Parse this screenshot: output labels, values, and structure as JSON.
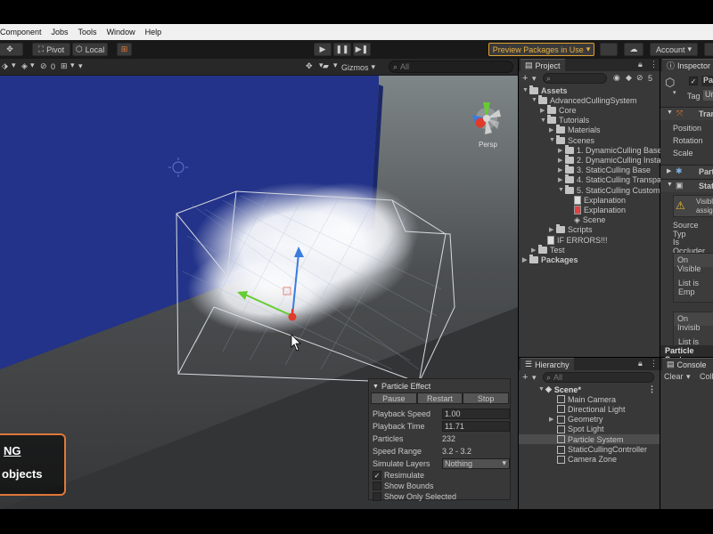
{
  "menu": [
    "Component",
    "Jobs",
    "Tools",
    "Window",
    "Help"
  ],
  "toolbar": {
    "pivot": "Pivot",
    "local": "Local",
    "preview_packages": "Preview Packages in Use",
    "account": "Account"
  },
  "scene_toolbar": {
    "hidden_count": "0",
    "gizmos": "Gizmos",
    "search_placeholder": "All",
    "persp": "Persp"
  },
  "project": {
    "tab": "Project",
    "counter": "5",
    "tree": [
      {
        "label": "Assets",
        "depth": 0,
        "icon": "folder",
        "expanded": true,
        "bold": true
      },
      {
        "label": "AdvancedCullingSystem",
        "depth": 1,
        "icon": "folder",
        "expanded": true
      },
      {
        "label": "Core",
        "depth": 2,
        "icon": "folder",
        "expanded": false
      },
      {
        "label": "Tutorials",
        "depth": 2,
        "icon": "folder",
        "expanded": true
      },
      {
        "label": "Materials",
        "depth": 3,
        "icon": "folder",
        "expanded": false
      },
      {
        "label": "Scenes",
        "depth": 3,
        "icon": "folder",
        "expanded": true
      },
      {
        "label": "1. DynamicCulling Base",
        "depth": 4,
        "icon": "folder",
        "expanded": false
      },
      {
        "label": "2. DynamicCulling Insta",
        "depth": 4,
        "icon": "folder",
        "expanded": false
      },
      {
        "label": "3. StaticCulling Base",
        "depth": 4,
        "icon": "folder",
        "expanded": false
      },
      {
        "label": "4. StaticCulling Transpa",
        "depth": 4,
        "icon": "folder",
        "expanded": false
      },
      {
        "label": "5. StaticCulling Custom",
        "depth": 4,
        "icon": "folder",
        "expanded": true
      },
      {
        "label": "Explanation",
        "depth": 5,
        "icon": "doc"
      },
      {
        "label": "Explanation",
        "depth": 5,
        "icon": "pdf"
      },
      {
        "label": "Scene",
        "depth": 5,
        "icon": "unity"
      },
      {
        "label": "Scripts",
        "depth": 3,
        "icon": "folder",
        "expanded": false
      },
      {
        "label": "IF ERRORS!!!",
        "depth": 2,
        "icon": "doc"
      },
      {
        "label": "Test",
        "depth": 1,
        "icon": "folder",
        "expanded": false
      },
      {
        "label": "Packages",
        "depth": 0,
        "icon": "folder",
        "expanded": false,
        "bold": true
      }
    ]
  },
  "hierarchy": {
    "tab": "Hierarchy",
    "search_placeholder": "All",
    "scene": "Scene*",
    "items": [
      {
        "label": "Main Camera",
        "arrow": false,
        "selected": false
      },
      {
        "label": "Directional Light",
        "arrow": false,
        "selected": false
      },
      {
        "label": "Geometry",
        "arrow": true,
        "selected": false
      },
      {
        "label": "Spot Light",
        "arrow": false,
        "selected": false
      },
      {
        "label": "Particle System",
        "arrow": false,
        "selected": true
      },
      {
        "label": "StaticCullingController",
        "arrow": false,
        "selected": false
      },
      {
        "label": "Camera Zone",
        "arrow": false,
        "selected": false
      }
    ]
  },
  "inspector": {
    "tab": "Inspector",
    "name_partial": "Pa",
    "tag_label": "Tag",
    "tag_value_partial": "Ur",
    "transform_partial": "Tran",
    "position": "Position",
    "rotation": "Rotation",
    "scale": "Scale",
    "particle_partial": "Parti",
    "static_partial": "Stat",
    "warning_partial_1": "Visibl",
    "warning_partial_2": "assign",
    "source_type_partial": "Source Typ",
    "is_occluder_partial": "Is Occluder",
    "on_visible_partial": "On Visible",
    "list_empty_partial_1": "List is Emp",
    "on_invisible_partial": "On Invisib",
    "list_empty_partial_2": "List is Emp",
    "particle_system_partial": "Particle Syst"
  },
  "console": {
    "tab": "Console",
    "clear": "Clear",
    "collapse_partial": "Coll"
  },
  "particle_effect": {
    "title": "Particle Effect",
    "pause": "Pause",
    "restart": "Restart",
    "stop": "Stop",
    "playback_speed_label": "Playback Speed",
    "playback_speed": "1.00",
    "playback_time_label": "Playback Time",
    "playback_time": "11.71",
    "particles_label": "Particles",
    "particles": "232",
    "speed_range_label": "Speed Range",
    "speed_range": "3.2 - 3.2",
    "simulate_layers_label": "Simulate Layers",
    "simulate_layers": "Nothing",
    "resimulate": "Resimulate",
    "resimulate_checked": true,
    "show_bounds": "Show Bounds",
    "show_bounds_checked": false,
    "show_only_selected": "Show Only Selected",
    "show_only_selected_checked": false
  },
  "promo": {
    "line1": "NG",
    "line2": "objects"
  }
}
